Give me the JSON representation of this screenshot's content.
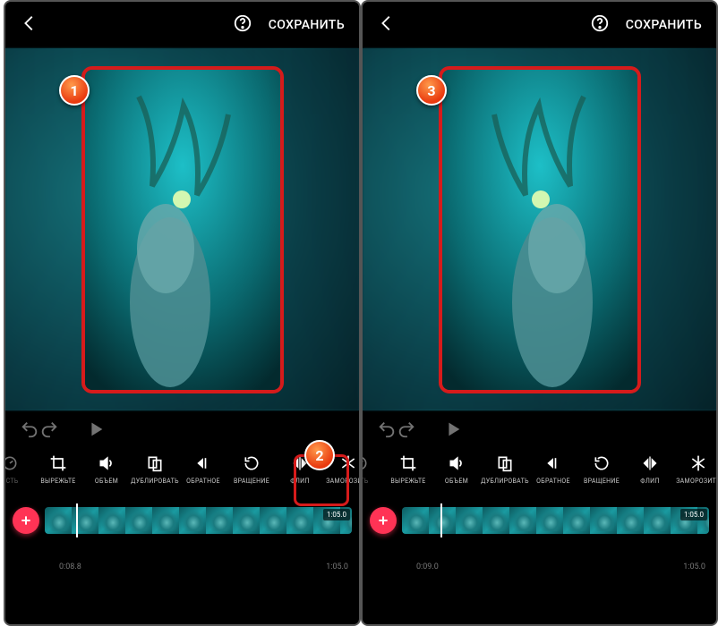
{
  "header": {
    "save_label": "СОХРАНИТЬ"
  },
  "tools": [
    {
      "id": "speed",
      "icon": "speed",
      "label": "ОСТЬ"
    },
    {
      "id": "crop",
      "icon": "crop",
      "label": "ВЫРЕЖЬТЕ"
    },
    {
      "id": "volume",
      "icon": "volume",
      "label": "ОБЪЕМ"
    },
    {
      "id": "duplicate",
      "icon": "duplicate",
      "label": "ДУБЛИРОВАТЬ"
    },
    {
      "id": "reverse",
      "icon": "reverse",
      "label": "ОБРАТНОЕ"
    },
    {
      "id": "rotate",
      "icon": "rotate",
      "label": "ВРАЩЕНИЕ"
    },
    {
      "id": "flip",
      "icon": "flip",
      "label": "ФЛИП"
    },
    {
      "id": "freeze",
      "icon": "freeze",
      "label": "ЗАМОРОЗИТЬ"
    }
  ],
  "timeline": {
    "left": {
      "current": "0:08.8",
      "total": "1:05.0",
      "dur_badge": "1:05.0",
      "playhead_pct": 20
    },
    "right": {
      "current": "0:09.0",
      "total": "1:05.0",
      "dur_badge": "1:05.0",
      "playhead_pct": 22
    }
  },
  "callouts": {
    "c1": "1",
    "c2": "2",
    "c3": "3"
  }
}
